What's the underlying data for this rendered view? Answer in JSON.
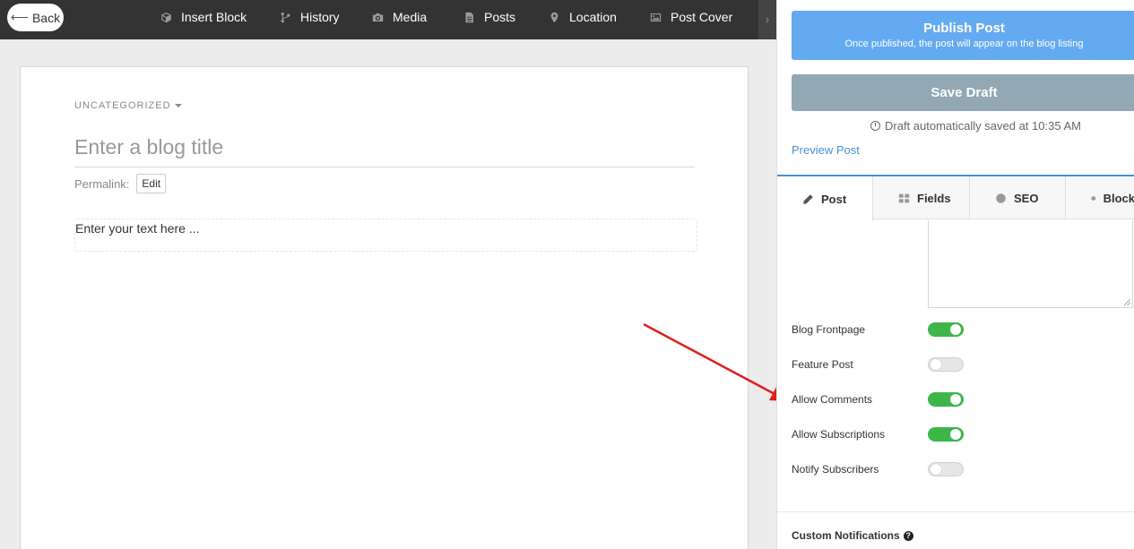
{
  "toolbar": {
    "back_label": "Back",
    "items": [
      {
        "label": "Insert Block",
        "icon": "cube-icon"
      },
      {
        "label": "History",
        "icon": "branch-icon"
      },
      {
        "label": "Media",
        "icon": "camera-icon"
      },
      {
        "label": "Posts",
        "icon": "document-icon"
      },
      {
        "label": "Location",
        "icon": "map-pin-icon"
      },
      {
        "label": "Post Cover",
        "icon": "image-icon"
      }
    ],
    "scroll_glyph": "›"
  },
  "editor": {
    "category": "UNCATEGORIZED",
    "title_placeholder": "Enter a blog title",
    "permalink_label": "Permalink:",
    "permalink_edit": "Edit",
    "content_placeholder": "Enter your text here ..."
  },
  "sidebar": {
    "publish_title": "Publish Post",
    "publish_subtitle": "Once published, the post will appear on the blog listing",
    "save_draft": "Save Draft",
    "saved_status": "Draft automatically saved at 10:35 AM",
    "preview_link": "Preview Post",
    "tabs": [
      {
        "label": "Post",
        "icon": "pencil-icon",
        "active": true
      },
      {
        "label": "Fields",
        "icon": "grid-icon",
        "active": false
      },
      {
        "label": "SEO",
        "icon": "globe-icon",
        "active": false
      },
      {
        "label": "Block",
        "icon": "cube-icon",
        "active": false
      }
    ],
    "settings": [
      {
        "label": "Blog Frontpage",
        "enabled": true
      },
      {
        "label": "Feature Post",
        "enabled": false
      },
      {
        "label": "Allow Comments",
        "enabled": true
      },
      {
        "label": "Allow Subscriptions",
        "enabled": true
      },
      {
        "label": "Notify Subscribers",
        "enabled": false
      }
    ],
    "custom_notifications": "Custom Notifications",
    "help_glyph": "?"
  },
  "colors": {
    "toolbar_bg": "#333333",
    "publish_blue": "#64aaf0",
    "draft_gray": "#92a8b4",
    "toggle_on": "#3cb54a",
    "link_blue": "#4a90d9",
    "annotation_red": "#e0201c"
  }
}
